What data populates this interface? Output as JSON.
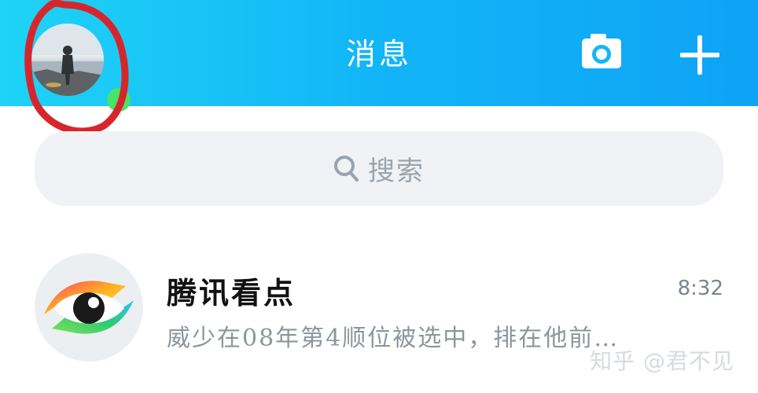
{
  "header": {
    "title": "消息",
    "gradient_start": "#1fd3f6",
    "gradient_end": "#0ea3f6",
    "avatar_icon": "user-avatar",
    "camera_icon": "camera-icon",
    "plus_icon": "plus-icon"
  },
  "search": {
    "label": "搜索",
    "icon": "search-icon"
  },
  "conversations": [
    {
      "title": "腾讯看点",
      "time": "8:32",
      "preview": "威少在08年第4顺位被选中，排在他前…",
      "icon": "eye-icon"
    }
  ],
  "watermark": "知乎 @君不见",
  "colors": {
    "annotation": "#d7262b",
    "online": "#47e36a",
    "search_bg": "#f0f2f5"
  }
}
